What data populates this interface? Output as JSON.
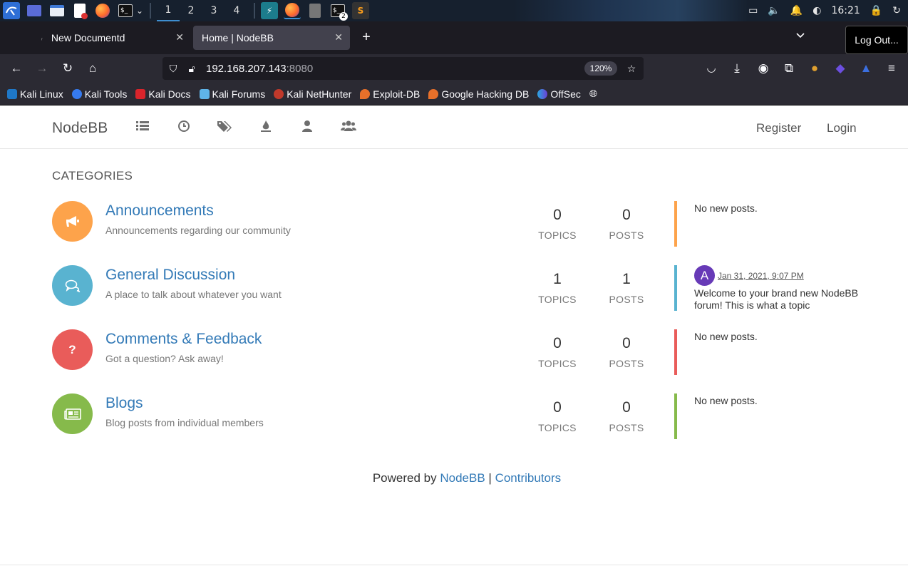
{
  "taskbar": {
    "workspaces": [
      "1",
      "2",
      "3",
      "4"
    ],
    "active_workspace": "1",
    "terminal_badge": "2",
    "clock": "16:21"
  },
  "browser": {
    "tabs": [
      {
        "title": "New Documentd",
        "active": false
      },
      {
        "title": "Home | NodeBB",
        "active": true
      }
    ],
    "tooltip": "Log Out...",
    "url_host": "192.168.207.143",
    "url_port": ":8080",
    "zoom": "120%",
    "bookmarks": [
      {
        "label": "Kali Linux",
        "color": "#1f78c8"
      },
      {
        "label": "Kali Tools",
        "color": "#367bf0"
      },
      {
        "label": "Kali Docs",
        "color": "#d9242b"
      },
      {
        "label": "Kali Forums",
        "color": "#5fb4e8"
      },
      {
        "label": "Kali NetHunter",
        "color": "#c0392b"
      },
      {
        "label": "Exploit-DB",
        "color": "#e8702a"
      },
      {
        "label": "Google Hacking DB",
        "color": "#e8702a"
      },
      {
        "label": "OffSec",
        "color": "#4a6fd9"
      }
    ]
  },
  "site": {
    "brand": "NodeBB",
    "nav_icons": [
      "categories-icon",
      "recent-icon",
      "tags-icon",
      "popular-icon",
      "users-icon",
      "groups-icon"
    ],
    "register": "Register",
    "login": "Login",
    "section_title": "CATEGORIES",
    "categories": [
      {
        "title": "Announcements",
        "description": "Announcements regarding our community",
        "icon": "bullhorn-icon",
        "color": "#fda34b",
        "topics": "0",
        "posts": "0",
        "topics_label": "TOPICS",
        "posts_label": "POSTS",
        "teaser": "No new posts."
      },
      {
        "title": "General Discussion",
        "description": "A place to talk about whatever you want",
        "icon": "comments-icon",
        "color": "#59b3d0",
        "topics": "1",
        "posts": "1",
        "topics_label": "TOPICS",
        "posts_label": "POSTS",
        "teaser_avatar": "A",
        "teaser_time": "Jan 31, 2021, 9:07 PM",
        "teaser_content": "Welcome to your brand new NodeBB forum! This is what a topic"
      },
      {
        "title": "Comments & Feedback",
        "description": "Got a question? Ask away!",
        "icon": "question-icon",
        "color": "#e95c5a",
        "topics": "0",
        "posts": "0",
        "topics_label": "TOPICS",
        "posts_label": "POSTS",
        "teaser": "No new posts."
      },
      {
        "title": "Blogs",
        "description": "Blog posts from individual members",
        "icon": "newspaper-icon",
        "color": "#86ba4b",
        "topics": "0",
        "posts": "0",
        "topics_label": "TOPICS",
        "posts_label": "POSTS",
        "teaser": "No new posts."
      }
    ],
    "footer_prefix": "Powered by",
    "footer_link1": "NodeBB",
    "footer_sep": "|",
    "footer_link2": "Contributors"
  }
}
